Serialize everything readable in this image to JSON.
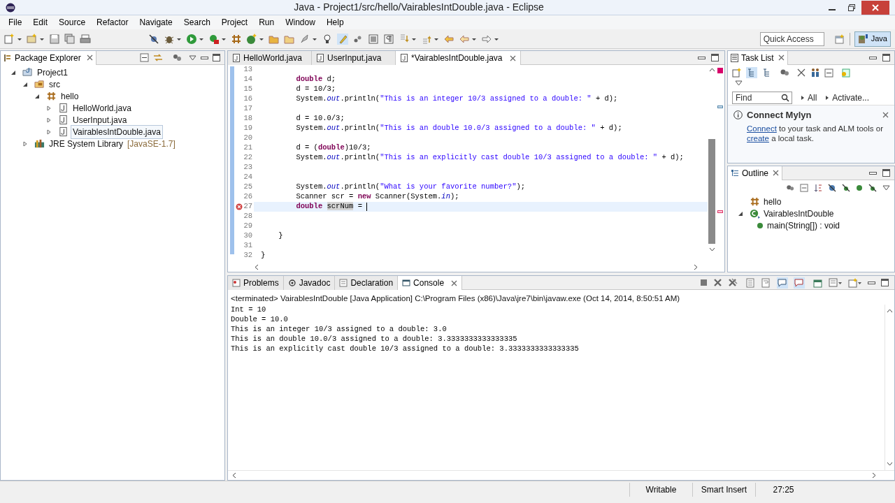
{
  "window": {
    "title": "Java - Project1/src/hello/VairablesIntDouble.java - Eclipse"
  },
  "menu": [
    "File",
    "Edit",
    "Source",
    "Refactor",
    "Navigate",
    "Search",
    "Project",
    "Run",
    "Window",
    "Help"
  ],
  "quick_access": {
    "placeholder": "Quick Access"
  },
  "perspective": {
    "label": "Java",
    "selected": true
  },
  "package_explorer": {
    "title": "Package Explorer",
    "tree": [
      {
        "label": "Project1",
        "kind": "project",
        "expanded": true,
        "selected": false,
        "children": [
          {
            "label": "src",
            "kind": "folder",
            "expanded": true,
            "selected": false,
            "children": [
              {
                "label": "hello",
                "kind": "package",
                "expanded": true,
                "selected": false,
                "children": [
                  {
                    "label": "HelloWorld.java",
                    "kind": "file",
                    "expanded": false,
                    "selected": false
                  },
                  {
                    "label": "UserInput.java",
                    "kind": "file",
                    "expanded": false,
                    "selected": false
                  },
                  {
                    "label": "VairablesIntDouble.java",
                    "kind": "file",
                    "expanded": false,
                    "selected": true
                  }
                ]
              }
            ]
          },
          {
            "label": "JRE System Library",
            "suffix": "[JavaSE-1.7]",
            "kind": "library",
            "expanded": false,
            "selected": false
          }
        ]
      }
    ]
  },
  "editor": {
    "tabs": [
      {
        "label": "HelloWorld.java",
        "selected": false
      },
      {
        "label": "UserInput.java",
        "selected": false
      },
      {
        "label": "*VairablesIntDouble.java",
        "selected": true
      }
    ],
    "lines": [
      {
        "number": "13",
        "current": false,
        "error": false
      },
      {
        "number": "14",
        "current": false,
        "error": false,
        "tokens": [
          {
            "kind": "keyword",
            "text": "        double"
          },
          {
            "kind": "plain",
            "text": " d;"
          }
        ]
      },
      {
        "number": "15",
        "current": false,
        "error": false,
        "tokens": [
          {
            "kind": "plain",
            "text": "        d = 10/3;"
          }
        ]
      },
      {
        "number": "16",
        "current": false,
        "error": false,
        "tokens": [
          {
            "kind": "plain",
            "text": "        System."
          },
          {
            "kind": "field",
            "text": "out"
          },
          {
            "kind": "plain",
            "text": ".println("
          },
          {
            "kind": "string",
            "text": "\"This is an integer 10/3 assigned to a double: \""
          },
          {
            "kind": "plain",
            "text": " + d);"
          }
        ]
      },
      {
        "number": "17",
        "current": false,
        "error": false
      },
      {
        "number": "18",
        "current": false,
        "error": false,
        "tokens": [
          {
            "kind": "plain",
            "text": "        d = 10.0/3;"
          }
        ]
      },
      {
        "number": "19",
        "current": false,
        "error": false,
        "tokens": [
          {
            "kind": "plain",
            "text": "        System."
          },
          {
            "kind": "field",
            "text": "out"
          },
          {
            "kind": "plain",
            "text": ".println("
          },
          {
            "kind": "string",
            "text": "\"This is an double 10.0/3 assigned to a double: \""
          },
          {
            "kind": "plain",
            "text": " + d);"
          }
        ]
      },
      {
        "number": "20",
        "current": false,
        "error": false
      },
      {
        "number": "21",
        "current": false,
        "error": false,
        "tokens": [
          {
            "kind": "plain",
            "text": "        d = ("
          },
          {
            "kind": "keyword",
            "text": "double"
          },
          {
            "kind": "plain",
            "text": ")10/3;"
          }
        ]
      },
      {
        "number": "22",
        "current": false,
        "error": false,
        "tokens": [
          {
            "kind": "plain",
            "text": "        System."
          },
          {
            "kind": "field",
            "text": "out"
          },
          {
            "kind": "plain",
            "text": ".println("
          },
          {
            "kind": "string",
            "text": "\"This is an explicitly cast double 10/3 assigned to a double: \""
          },
          {
            "kind": "plain",
            "text": " + d);"
          }
        ]
      },
      {
        "number": "23",
        "current": false,
        "error": false
      },
      {
        "number": "24",
        "current": false,
        "error": false
      },
      {
        "number": "25",
        "current": false,
        "error": false,
        "tokens": [
          {
            "kind": "plain",
            "text": "        System."
          },
          {
            "kind": "field",
            "text": "out"
          },
          {
            "kind": "plain",
            "text": ".println("
          },
          {
            "kind": "string",
            "text": "\"What is your favorite number?\""
          },
          {
            "kind": "plain",
            "text": ");"
          }
        ]
      },
      {
        "number": "26",
        "current": false,
        "error": false,
        "tokens": [
          {
            "kind": "plain",
            "text": "        Scanner scr = "
          },
          {
            "kind": "keyword",
            "text": "new"
          },
          {
            "kind": "plain",
            "text": " Scanner(System."
          },
          {
            "kind": "field",
            "text": "in"
          },
          {
            "kind": "plain",
            "text": ");"
          }
        ]
      },
      {
        "number": "27",
        "current": true,
        "error": true,
        "tokens": [
          {
            "kind": "keyword",
            "text": "        double "
          },
          {
            "kind": "occurrence",
            "text": "scrNum"
          },
          {
            "kind": "plain",
            "text": " = "
          }
        ]
      },
      {
        "number": "28",
        "current": false,
        "error": false
      },
      {
        "number": "29",
        "current": false,
        "error": false
      },
      {
        "number": "30",
        "current": false,
        "error": false,
        "tokens": [
          {
            "kind": "plain",
            "text": "    }"
          }
        ]
      },
      {
        "number": "31",
        "current": false,
        "error": false
      },
      {
        "number": "32",
        "current": false,
        "error": false,
        "tokens": [
          {
            "kind": "plain",
            "text": "}"
          }
        ]
      }
    ]
  },
  "task_list": {
    "title": "Task List",
    "find": {
      "placeholder": "Find"
    },
    "filters": [
      "All",
      "Activate..."
    ],
    "mylyn": {
      "title": "Connect Mylyn",
      "text": [
        {
          "text": "Connect",
          "link": true
        },
        {
          "text": " to your task and ALM tools or ",
          "link": false
        },
        {
          "text": "create",
          "link": true
        },
        {
          "text": " a local task.",
          "link": false
        }
      ]
    }
  },
  "outline": {
    "title": "Outline",
    "tree": [
      {
        "label": "hello",
        "kind": "package"
      },
      {
        "label": "VairablesIntDouble",
        "kind": "class",
        "expanded": true,
        "children": [
          {
            "label": "main(String[]) : void",
            "kind": "method"
          }
        ]
      }
    ]
  },
  "console": {
    "tabs": [
      {
        "label": "Problems",
        "selected": false
      },
      {
        "label": "Javadoc",
        "selected": false
      },
      {
        "label": "Declaration",
        "selected": false
      },
      {
        "label": "Console",
        "selected": true
      }
    ],
    "header": "<terminated> VairablesIntDouble [Java Application] C:\\Program Files (x86)\\Java\\jre7\\bin\\javaw.exe (Oct 14, 2014, 8:50:51 AM)",
    "lines": [
      "Int = 10",
      "Double = 10.0",
      "This is an integer 10/3 assigned to a double: 3.0",
      "This is an double 10.0/3 assigned to a double: 3.3333333333333335",
      "This is an explicitly cast double 10/3 assigned to a double: 3.3333333333333335"
    ]
  },
  "status_bar": [
    "Writable",
    "Smart Insert",
    "27:25"
  ]
}
